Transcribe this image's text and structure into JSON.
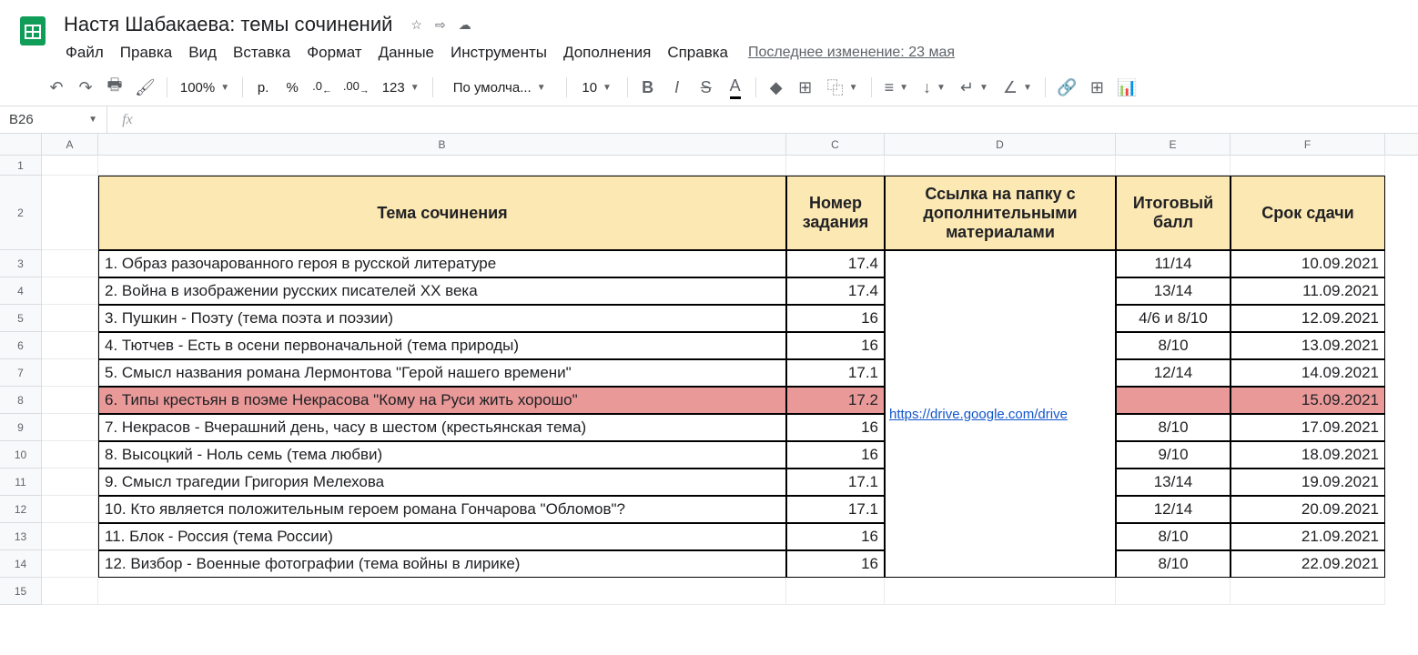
{
  "doc_title": "Настя Шабакаева: темы сочинений",
  "menu": {
    "file": "Файл",
    "edit": "Правка",
    "view": "Вид",
    "insert": "Вставка",
    "format": "Формат",
    "data": "Данные",
    "tools": "Инструменты",
    "addons": "Дополнения",
    "help": "Справка"
  },
  "last_edit": "Последнее изменение: 23 мая",
  "toolbar": {
    "zoom": "100%",
    "currency": "р.",
    "percent": "%",
    "dec_dec": ".0",
    "inc_dec": ".00",
    "num_fmt": "123",
    "font": "По умолча...",
    "font_size": "10"
  },
  "name_box": "B26",
  "columns": [
    "A",
    "B",
    "C",
    "D",
    "E",
    "F"
  ],
  "headers": {
    "topic": "Тема сочинения",
    "task_num": "Номер задания",
    "folder_link": "Ссылка на папку с дополнительными материалами",
    "final_score": "Итоговый балл",
    "deadline": "Срок сдачи"
  },
  "link_text": "https://drive.google.com/drive",
  "rows": [
    {
      "topic": "1. Образ разочарованного героя в русской литературе",
      "num": "17.4",
      "score": "11/14",
      "date": "10.09.2021",
      "pink": false
    },
    {
      "topic": "2. Война в изображении русских писателей XX века",
      "num": "17.4",
      "score": "13/14",
      "date": "11.09.2021",
      "pink": false
    },
    {
      "topic": "3. Пушкин - Поэту (тема поэта и поэзии)",
      "num": "16",
      "score": "4/6 и 8/10",
      "date": "12.09.2021",
      "pink": false
    },
    {
      "topic": "4. Тютчев - Есть в осени первоначальной (тема природы)",
      "num": "16",
      "score": "8/10",
      "date": "13.09.2021",
      "pink": false
    },
    {
      "topic": "5. Смысл названия романа Лермонтова \"Герой нашего времени\"",
      "num": "17.1",
      "score": "12/14",
      "date": "14.09.2021",
      "pink": false
    },
    {
      "topic": "6. Типы крестьян в поэме Некрасова \"Кому на Руси жить хорошо\"",
      "num": "17.2",
      "score": "",
      "date": "15.09.2021",
      "pink": true
    },
    {
      "topic": "7. Некрасов - Вчерашний день, часу в шестом (крестьянская тема)",
      "num": "16",
      "score": "8/10",
      "date": "17.09.2021",
      "pink": false
    },
    {
      "topic": "8. Высоцкий - Ноль семь (тема любви)",
      "num": "16",
      "score": "9/10",
      "date": "18.09.2021",
      "pink": false
    },
    {
      "topic": "9. Смысл трагедии Григория Мелехова",
      "num": "17.1",
      "score": "13/14",
      "date": "19.09.2021",
      "pink": false
    },
    {
      "topic": "10. Кто является положительным героем романа Гончарова \"Обломов\"?",
      "num": "17.1",
      "score": "12/14",
      "date": "20.09.2021",
      "pink": false
    },
    {
      "topic": "11. Блок - Россия (тема России)",
      "num": "16",
      "score": "8/10",
      "date": "21.09.2021",
      "pink": false
    },
    {
      "topic": "12. Визбор - Военные фотографии (тема войны в лирике)",
      "num": "16",
      "score": "8/10",
      "date": "22.09.2021",
      "pink": false
    }
  ]
}
